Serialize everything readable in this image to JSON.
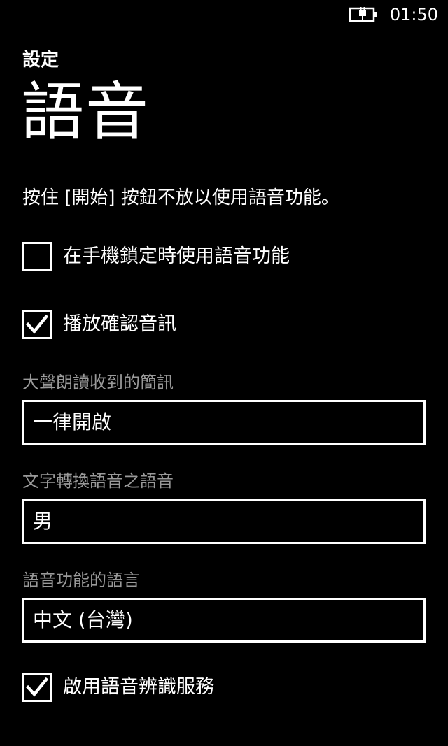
{
  "status_bar": {
    "battery_icon": "battery-charging-icon",
    "time": "01:50"
  },
  "header": {
    "app_title": "設定",
    "page_title": "語音"
  },
  "hint_text": "按住 [開始] 按鈕不放以使用語音功能。",
  "options": [
    {
      "label": "在手機鎖定時使用語音功能",
      "checked": false
    },
    {
      "label": "播放確認音訊",
      "checked": true
    }
  ],
  "pickers": [
    {
      "label": "大聲朗讀收到的簡訊",
      "value": "一律開啟"
    },
    {
      "label": "文字轉換語音之語音",
      "value": "男"
    },
    {
      "label": "語音功能的語言",
      "value": "中文 (台灣)"
    }
  ],
  "speech_recognition": {
    "label": "啟用語音辨識服務",
    "checked": true
  },
  "colors": {
    "background": "#000000",
    "foreground": "#ffffff",
    "subtle_label": "#9a9a9a"
  }
}
